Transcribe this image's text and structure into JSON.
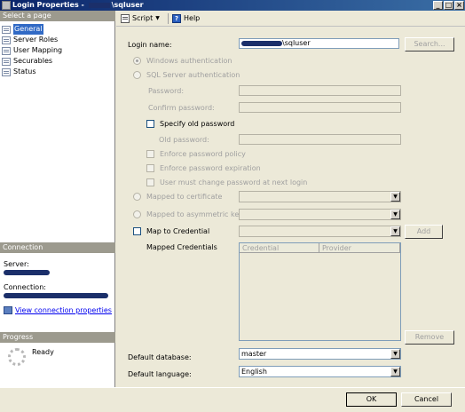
{
  "window": {
    "title_prefix": "Login Properties - ",
    "title_suffix": "\\sqluser"
  },
  "left": {
    "select_page_header": "Select a page",
    "pages": [
      "General",
      "Server Roles",
      "User Mapping",
      "Securables",
      "Status"
    ],
    "selected_page": "General",
    "connection_header": "Connection",
    "server_label": "Server:",
    "connection_label": "Connection:",
    "view_connection_link": "View connection properties",
    "progress_header": "Progress",
    "progress_status": "Ready"
  },
  "toolbar": {
    "script_label": "Script",
    "help_label": "Help"
  },
  "general": {
    "login_name_label": "Login name:",
    "login_name_value": "\\sqluser",
    "search_button": "Search...",
    "windows_auth": "Windows authentication",
    "sql_auth": "SQL Server authentication",
    "password_label": "Password:",
    "confirm_password_label": "Confirm password:",
    "specify_old_password": "Specify old password",
    "old_password_label": "Old password:",
    "enforce_policy": "Enforce password policy",
    "enforce_expiration": "Enforce password expiration",
    "must_change": "User must change password at next login",
    "mapped_to_certificate": "Mapped to certificate",
    "mapped_to_asym_key": "Mapped to asymmetric key",
    "map_to_credential": "Map to Credential",
    "add_button": "Add",
    "mapped_credentials_label": "Mapped Credentials",
    "grid_col_credential": "Credential",
    "grid_col_provider": "Provider",
    "remove_button": "Remove",
    "default_database_label": "Default database:",
    "default_database_value": "master",
    "default_language_label": "Default language:",
    "default_language_value": "English"
  },
  "footer": {
    "ok_button": "OK",
    "cancel_button": "Cancel"
  }
}
